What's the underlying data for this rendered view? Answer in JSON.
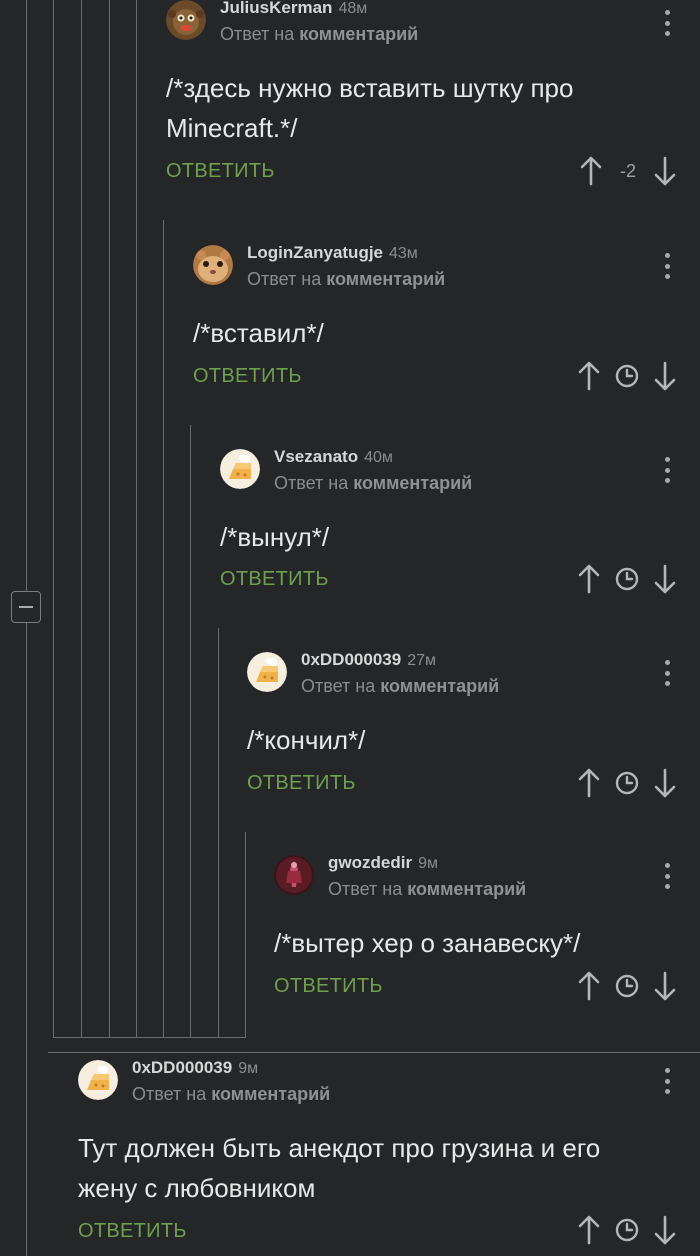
{
  "comments": [
    {
      "author": "JuliusKerman",
      "time": "48м",
      "reply_prefix": "Ответ на",
      "reply_target": "комментарий",
      "text": "/*здесь нужно вставить шутку про Minecraft.*/",
      "reply_label": "ОТВЕТИТЬ",
      "score": "-2"
    },
    {
      "author": "LoginZanyatugje",
      "time": "43м",
      "reply_prefix": "Ответ на",
      "reply_target": "комментарий",
      "text": "/*вставил*/",
      "reply_label": "ОТВЕТИТЬ"
    },
    {
      "author": "Vsezanato",
      "time": "40м",
      "reply_prefix": "Ответ на",
      "reply_target": "комментарий",
      "text": "/*вынул*/",
      "reply_label": "ОТВЕТИТЬ"
    },
    {
      "author": "0xDD000039",
      "time": "27м",
      "reply_prefix": "Ответ на",
      "reply_target": "комментарий",
      "text": "/*кончил*/",
      "reply_label": "ОТВЕТИТЬ"
    },
    {
      "author": "gwozdedir",
      "time": "9м",
      "reply_prefix": "Ответ на",
      "reply_target": "комментарий",
      "text": "/*вытер хер о занавеску*/",
      "reply_label": "ОТВЕТИТЬ"
    },
    {
      "author": "0xDD000039",
      "time": "9м",
      "reply_prefix": "Ответ на",
      "reply_target": "комментарий",
      "text": "Тут должен быть анекдот про грузина и его жену с любовником",
      "reply_label": "ОТВЕТИТЬ"
    }
  ],
  "colors": {
    "accent": "#6fa04e",
    "background": "#242628",
    "thread": "#6a6c6e"
  },
  "icons": [
    "upvote-icon",
    "downvote-icon",
    "save-later-icon",
    "more-menu-icon",
    "collapse-icon"
  ]
}
